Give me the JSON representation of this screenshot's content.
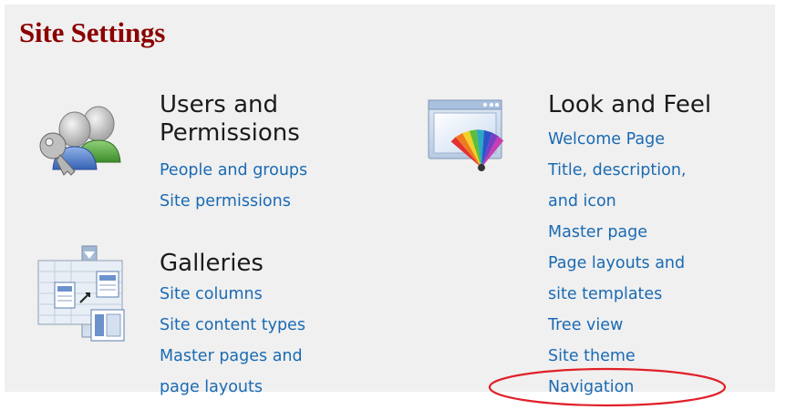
{
  "page": {
    "title": "Site Settings"
  },
  "sections": {
    "users": {
      "title_line1": "Users and",
      "title_line2": "Permissions",
      "links": [
        "People and groups",
        "Site permissions"
      ]
    },
    "galleries": {
      "title": "Galleries",
      "links": [
        {
          "line1": "Site columns"
        },
        {
          "line1": "Site content types"
        },
        {
          "line1": "Master pages and",
          "line2": "page layouts"
        }
      ]
    },
    "look": {
      "title": "Look and Feel",
      "links": [
        {
          "line1": "Welcome Page"
        },
        {
          "line1": "Title, description,",
          "line2": "and icon"
        },
        {
          "line1": "Master page"
        },
        {
          "line1": "Page layouts and",
          "line2": "site templates"
        },
        {
          "line1": "Tree view"
        },
        {
          "line1": "Site theme"
        },
        {
          "line1": "Navigation"
        }
      ]
    }
  },
  "annotation": {
    "color": "#e0202a"
  },
  "colors": {
    "title": "#8b0000",
    "link": "#1a6ab3",
    "panel": "#f0f0f0"
  },
  "icons": {
    "users": "users-key-icon",
    "galleries": "gallery-icon",
    "look": "palette-window-icon"
  }
}
